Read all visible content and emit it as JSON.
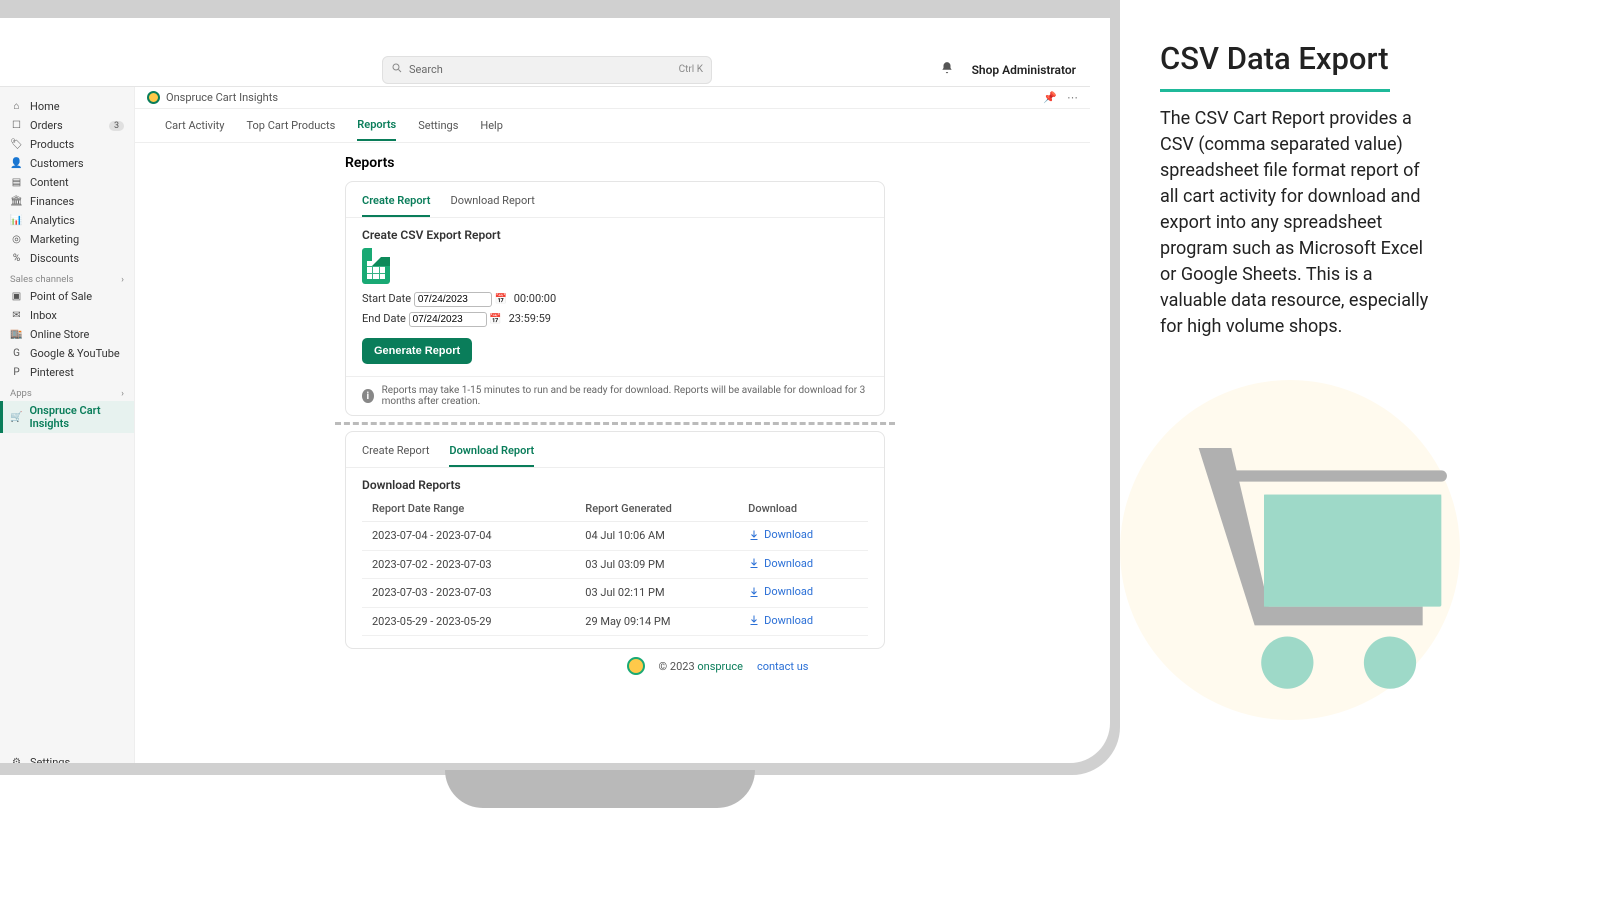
{
  "topbar": {
    "search_placeholder": "Search",
    "search_hint": "Ctrl K",
    "admin_label": "Shop Administrator"
  },
  "sidebar": {
    "nav": [
      {
        "label": "Home",
        "icon": "home-icon"
      },
      {
        "label": "Orders",
        "icon": "orders-icon",
        "badge": "3"
      },
      {
        "label": "Products",
        "icon": "tag-icon"
      },
      {
        "label": "Customers",
        "icon": "person-icon"
      },
      {
        "label": "Content",
        "icon": "content-icon"
      },
      {
        "label": "Finances",
        "icon": "bank-icon"
      },
      {
        "label": "Analytics",
        "icon": "chart-icon"
      },
      {
        "label": "Marketing",
        "icon": "target-icon"
      },
      {
        "label": "Discounts",
        "icon": "percent-icon"
      }
    ],
    "channels_header": "Sales channels",
    "channels": [
      {
        "label": "Point of Sale"
      },
      {
        "label": "Inbox"
      },
      {
        "label": "Online Store"
      },
      {
        "label": "Google & YouTube"
      },
      {
        "label": "Pinterest"
      }
    ],
    "apps_header": "Apps",
    "apps": [
      {
        "label": "Onspruce Cart Insights",
        "selected": true
      }
    ],
    "settings_label": "Settings"
  },
  "app_header": {
    "title": "Onspruce Cart Insights"
  },
  "app_tabs": [
    {
      "label": "Cart Activity"
    },
    {
      "label": "Top Cart Products"
    },
    {
      "label": "Reports",
      "active": true
    },
    {
      "label": "Settings"
    },
    {
      "label": "Help"
    }
  ],
  "reports_title": "Reports",
  "create_card": {
    "tabs": {
      "create": "Create Report",
      "download": "Download Report"
    },
    "heading": "Create CSV Export Report",
    "start_label": "Start Date",
    "start_value": "07/24/2023",
    "start_time": "00:00:00",
    "end_label": "End Date",
    "end_value": "07/24/2023",
    "end_time": "23:59:59",
    "button": "Generate Report",
    "info": "Reports may take 1-15 minutes to run and be ready for download. Reports will be available for download for 3 months after creation."
  },
  "download_card": {
    "tabs": {
      "create": "Create Report",
      "download": "Download Report"
    },
    "heading": "Download Reports",
    "cols": {
      "range": "Report Date Range",
      "gen": "Report Generated",
      "dl": "Download"
    },
    "rows": [
      {
        "range": "2023-07-04 - 2023-07-04",
        "gen": "04 Jul 10:06 AM",
        "dl": "Download"
      },
      {
        "range": "2023-07-02 - 2023-07-03",
        "gen": "03 Jul 03:09 PM",
        "dl": "Download"
      },
      {
        "range": "2023-07-03 - 2023-07-03",
        "gen": "03 Jul 02:11 PM",
        "dl": "Download"
      },
      {
        "range": "2023-05-29 - 2023-05-29",
        "gen": "29 May 09:14 PM",
        "dl": "Download"
      }
    ]
  },
  "footer": {
    "copyright": "© 2023 ",
    "brand": "onspruce",
    "contact": "contact us"
  },
  "promo": {
    "title": "CSV Data Export",
    "body": "The CSV Cart Report provides a CSV (comma separated value) spreadsheet file format report of all cart activity for download and export into any spreadsheet program such as Microsoft Excel or Google Sheets.  This is a valuable data resource, especially for high volume shops."
  }
}
